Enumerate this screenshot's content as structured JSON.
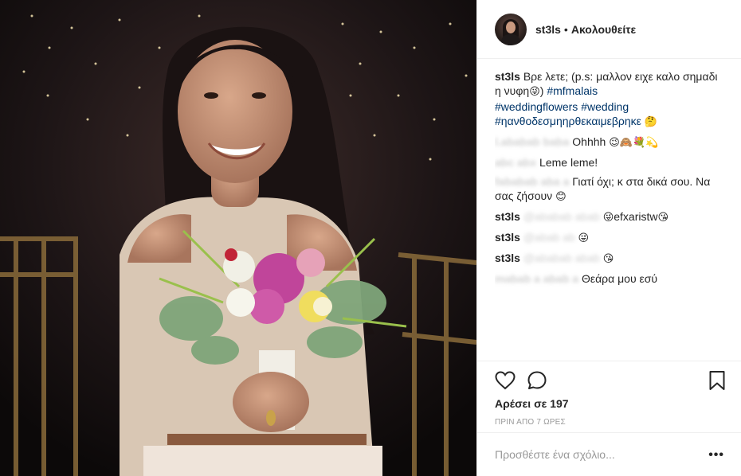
{
  "post": {
    "username": "st3ls",
    "separator": "•",
    "follow_status": "Ακολουθείτε",
    "photo_description": "woman holding bridal bouquet"
  },
  "comments": [
    {
      "user": "st3ls",
      "user_blurred": false,
      "text": "Βρε λετε; (p.s: μαλλον ειχε καλο σημαδι η νυφη",
      "emoji": "😜",
      "tags": [
        "#mfmalais",
        "#weddingflowers",
        "#wedding",
        "#ηανθοδεσμηηρθεκαιμεβρηκε"
      ],
      "tag_emoji": "🤔"
    },
    {
      "user": "l.",
      "user_blurred": true,
      "text": "Ohhhh",
      "emoji": "😉🙈💐💫"
    },
    {
      "user": "x",
      "user_blurred": true,
      "text": "Leme leme!",
      "emoji": ""
    },
    {
      "user": "f",
      "user_blurred": true,
      "text": "Γιατί όχι; κ στα δικά σου. Να σας ζήσουν",
      "emoji": "😊"
    },
    {
      "user": "st3ls",
      "user_blurred": false,
      "mention": "@",
      "text": "efxaristw",
      "emoji_before": "😜",
      "emoji": "😘"
    },
    {
      "user": "st3ls",
      "user_blurred": false,
      "mention": "@",
      "text": "",
      "emoji": "😜"
    },
    {
      "user": "st3ls",
      "user_blurred": false,
      "mention": "@",
      "text": "",
      "emoji": "😘"
    },
    {
      "user": "m",
      "user_blurred": true,
      "text": "Θεάρα μου εσύ",
      "emoji": ""
    }
  ],
  "actions": {
    "like_icon": "heart-icon",
    "comment_icon": "speech-bubble-icon",
    "save_icon": "bookmark-icon",
    "likes_label": "Αρέσει σε 197",
    "timestamp": "ΠΡΙΝ ΑΠΟ 7 ΩΡΕΣ"
  },
  "add_comment": {
    "placeholder": "Προσθέστε ένα σχόλιο...",
    "more_label": "•••"
  }
}
